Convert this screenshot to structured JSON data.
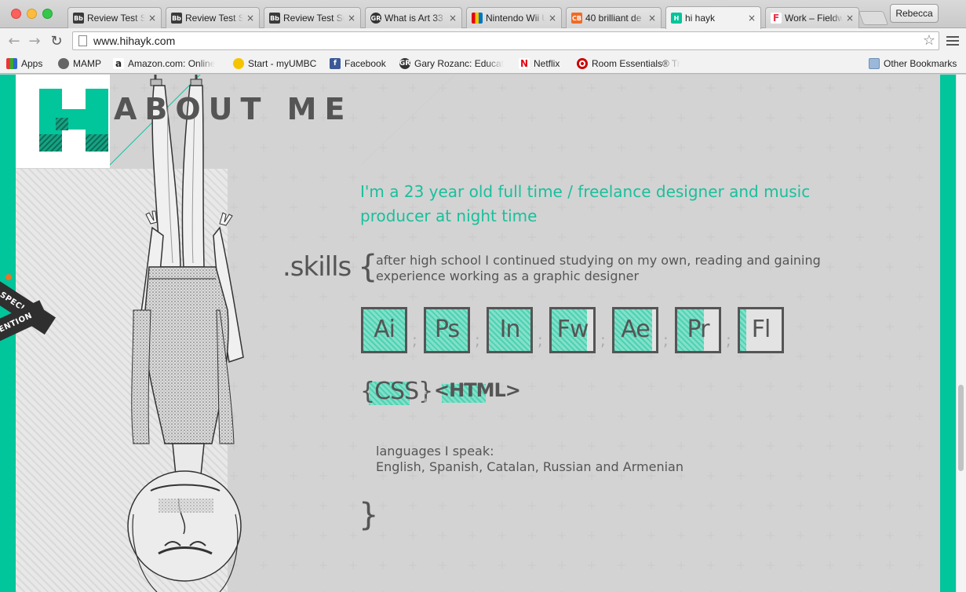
{
  "browser": {
    "tabs": [
      {
        "title": "Review Test Su",
        "icon": "blackboard-icon",
        "active": false
      },
      {
        "title": "Review Test Su",
        "icon": "blackboard-icon",
        "active": false
      },
      {
        "title": "Review Test Su",
        "icon": "blackboard-icon",
        "active": false
      },
      {
        "title": "What is Art 33",
        "icon": "gr-icon",
        "active": false
      },
      {
        "title": "Nintendo Wii U",
        "icon": "nintendo-icon",
        "active": false
      },
      {
        "title": "40 brilliant de",
        "icon": "creative-bloq-icon",
        "active": false
      },
      {
        "title": "hi hayk",
        "icon": "hihayk-icon",
        "active": true
      },
      {
        "title": "Work – Fieldwo",
        "icon": "fieldwork-icon",
        "active": false
      }
    ],
    "close_glyph": "×",
    "profile_name": "Rebecca",
    "url": "www.hihayk.com",
    "bookmarks": [
      {
        "label": "Apps",
        "icon": "apps-grid-icon"
      },
      {
        "label": "MAMP",
        "icon": "mamp-icon"
      },
      {
        "label": "Amazon.com: Online",
        "icon": "amazon-icon"
      },
      {
        "label": "Start - myUMBC",
        "icon": "paw-icon"
      },
      {
        "label": "Facebook",
        "icon": "facebook-icon"
      },
      {
        "label": "Gary Rozanc: Educat",
        "icon": "gr-icon"
      },
      {
        "label": "Netflix",
        "icon": "netflix-icon"
      },
      {
        "label": "Room Essentials® Tr",
        "icon": "target-icon"
      }
    ],
    "other_bookmarks": "Other Bookmarks"
  },
  "page": {
    "logo_heading": "ABOUT ME",
    "intro": "I'm a 23 year old full time / freelance designer and music producer at night time",
    "skills_title": ".skills",
    "open_brace": "{",
    "close_brace": "}",
    "skills_desc": "after high school I continued studying on my own, reading and gaining experience working as a graphic designer",
    "separator": ";",
    "tools": [
      {
        "label": "Ai",
        "level": 1.0
      },
      {
        "label": "Ps",
        "level": 1.0
      },
      {
        "label": "In",
        "level": 1.0
      },
      {
        "label": "Fw",
        "level": 0.85
      },
      {
        "label": "Ae",
        "level": 0.9
      },
      {
        "label": "Pr",
        "level": 0.65
      },
      {
        "label": "Fl",
        "level": 0.15
      }
    ],
    "css_label": "{CSS}",
    "html_label": "<HTML>",
    "languages_title": "languages I speak:",
    "languages": "English, Spanish, Catalan, Russian and Armenian",
    "ribbon_top": "SPECIAL",
    "ribbon_bottom": "MENTION"
  },
  "colors": {
    "accent": "#01c59b",
    "text": "#555555",
    "intro": "#18c09c"
  }
}
